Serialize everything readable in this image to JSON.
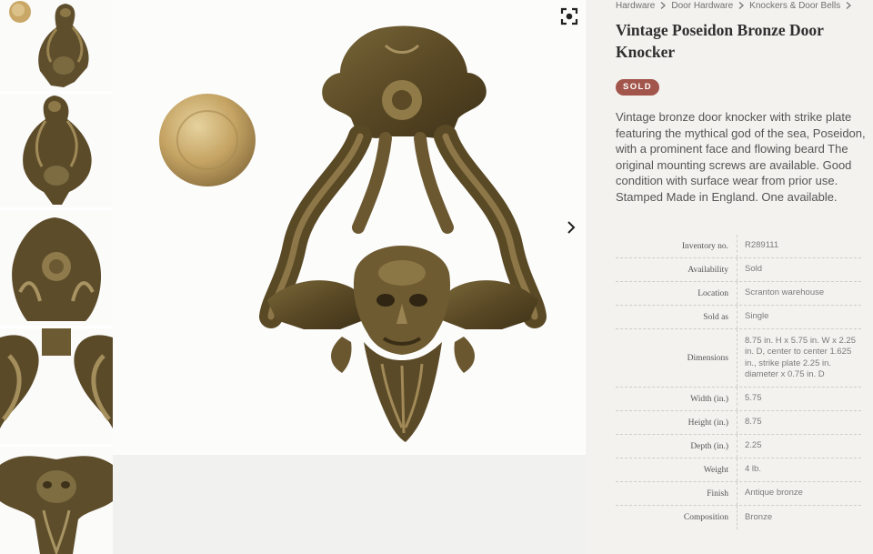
{
  "breadcrumb": [
    {
      "label": "Hardware"
    },
    {
      "label": "Door Hardware"
    },
    {
      "label": "Knockers & Door Bells"
    }
  ],
  "product": {
    "title": "Vintage Poseidon Bronze Door Knocker",
    "status_badge": "SOLD",
    "description": "Vintage bronze door knocker with strike plate featuring the mythical god of the sea, Poseidon, with a prominent face and flowing beard The original mounting screws are available. Good condition with surface wear from prior use. Stamped Made in England. One available."
  },
  "specs": [
    {
      "label": "Inventory no.",
      "value": "R289111"
    },
    {
      "label": "Availability",
      "value": "Sold"
    },
    {
      "label": "Location",
      "value": "Scranton warehouse"
    },
    {
      "label": "Sold as",
      "value": "Single"
    },
    {
      "label": "Dimensions",
      "value": "8.75 in. H x 5.75 in. W x 2.25 in. D, center to center 1.625 in., strike plate 2.25 in. diameter x 0.75 in. D"
    },
    {
      "label": "Width (in.)",
      "value": "5.75"
    },
    {
      "label": "Height (in.)",
      "value": "8.75"
    },
    {
      "label": "Depth (in.)",
      "value": "2.25"
    },
    {
      "label": "Weight",
      "value": "4 lb."
    },
    {
      "label": "Finish",
      "value": "Antique bronze"
    },
    {
      "label": "Composition",
      "value": "Bronze"
    }
  ],
  "thumbnails": [
    {
      "view": "full knocker with strike plate"
    },
    {
      "view": "full knocker"
    },
    {
      "view": "top detail"
    },
    {
      "view": "side detail"
    },
    {
      "view": "face detail"
    }
  ],
  "icons": {
    "fullscreen": "fullscreen-icon",
    "next": "chevron-right-icon",
    "breadcrumb_separator": "chevron-right-icon"
  },
  "colors": {
    "sold_badge": "#a2554a",
    "bronze": "#6b5a35",
    "panel_background": "#f3f2ef"
  }
}
